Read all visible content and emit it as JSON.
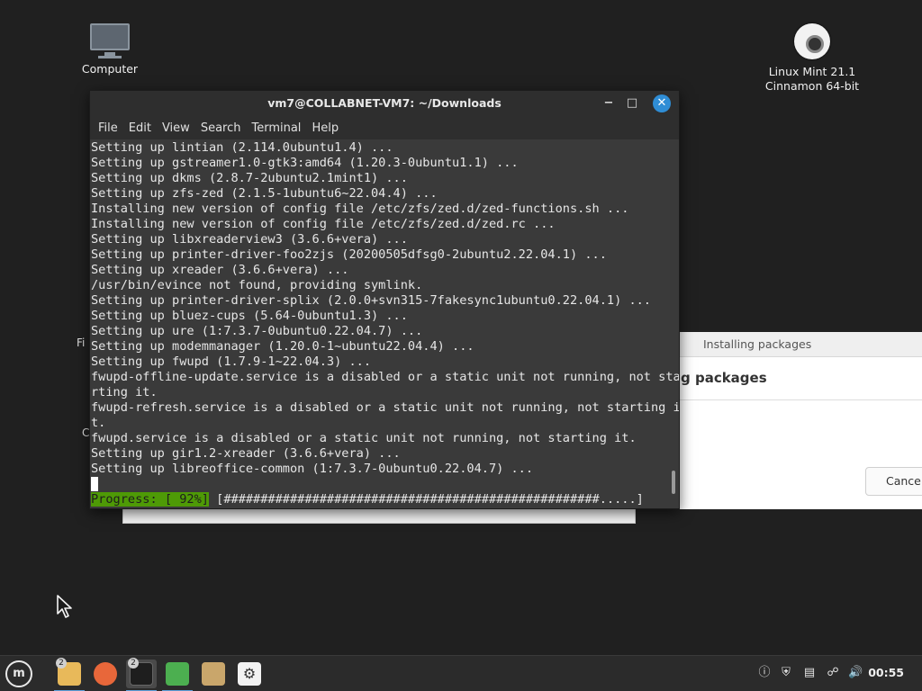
{
  "desktop": {
    "icons": [
      {
        "label": "Computer"
      },
      {
        "label_line1": "Linux Mint 21.1",
        "label_line2": "Cinnamon 64-bit"
      }
    ],
    "hidden_labels": [
      "Fi",
      "C"
    ]
  },
  "installer": {
    "title": "Installing packages",
    "heading": "g packages",
    "cancel_label": "Cancel"
  },
  "terminal": {
    "title": "vm7@COLLABNET-VM7: ~/Downloads",
    "menu": [
      "File",
      "Edit",
      "View",
      "Search",
      "Terminal",
      "Help"
    ],
    "lines": [
      "Setting up lintian (2.114.0ubuntu1.4) ...",
      "Setting up gstreamer1.0-gtk3:amd64 (1.20.3-0ubuntu1.1) ...",
      "Setting up dkms (2.8.7-2ubuntu2.1mint1) ...",
      "Setting up zfs-zed (2.1.5-1ubuntu6~22.04.4) ...",
      "Installing new version of config file /etc/zfs/zed.d/zed-functions.sh ...",
      "Installing new version of config file /etc/zfs/zed.d/zed.rc ...",
      "Setting up libxreaderview3 (3.6.6+vera) ...",
      "Setting up printer-driver-foo2zjs (20200505dfsg0-2ubuntu2.22.04.1) ...",
      "Setting up xreader (3.6.6+vera) ...",
      "/usr/bin/evince not found, providing symlink.",
      "Setting up printer-driver-splix (2.0.0+svn315-7fakesync1ubuntu0.22.04.1) ...",
      "Setting up bluez-cups (5.64-0ubuntu1.3) ...",
      "Setting up ure (1:7.3.7-0ubuntu0.22.04.7) ...",
      "Setting up modemmanager (1.20.0-1~ubuntu22.04.4) ...",
      "Setting up fwupd (1.7.9-1~22.04.3) ...",
      "fwupd-offline-update.service is a disabled or a static unit not running, not sta",
      "rting it.",
      "fwupd-refresh.service is a disabled or a static unit not running, not starting i",
      "t.",
      "fwupd.service is a disabled or a static unit not running, not starting it.",
      "Setting up gir1.2-xreader (3.6.6+vera) ...",
      "Setting up libreoffice-common (1:7.3.7-0ubuntu0.22.04.7) ..."
    ],
    "progress_label": "Progress: [ 92%]",
    "progress_bar": " [###################################################.....]",
    "progress_percent": 92
  },
  "taskbar": {
    "menu_label": "m",
    "files_badge": "2",
    "terminal_badge": "2",
    "clock": "00:55"
  }
}
